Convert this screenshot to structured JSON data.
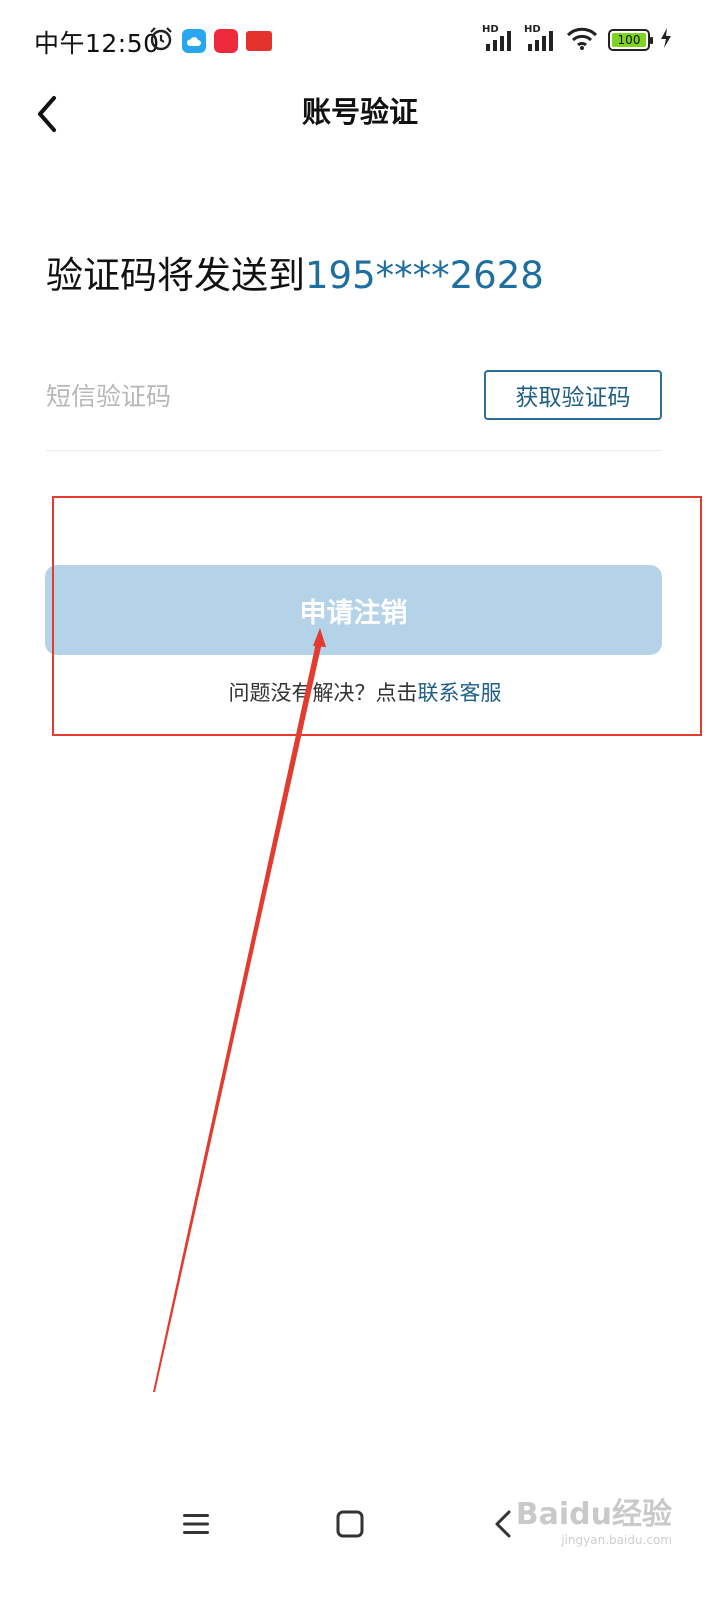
{
  "status_bar": {
    "time": "中午12:50",
    "app_icons": [
      {
        "name": "alarm-icon"
      },
      {
        "name": "cloud-app-icon",
        "color": "#28a7f0"
      },
      {
        "name": "xiaohongshu-app-icon",
        "color": "#ee2a3c"
      },
      {
        "name": "toutiao-app-icon",
        "color": "#e5322d"
      }
    ],
    "signal1_label": "HD",
    "signal2_label": "HD",
    "battery_level": "100",
    "battery_color": "#7ed321"
  },
  "header": {
    "title": "账号验证"
  },
  "verify": {
    "heading_prefix": "验证码将发送到",
    "phone": "195****2628",
    "sms_placeholder": "短信验证码",
    "sms_value": "",
    "get_code_label": "获取验证码",
    "apply_label": "申请注销",
    "help_prefix": "问题没有解决？点击",
    "help_link": "联系客服"
  },
  "colors": {
    "accent": "#1e6e9f",
    "apply_button_disabled": "#b4d3e8",
    "annotation": "#e23b30"
  },
  "watermark": {
    "main": "Baidu经验",
    "url": "jingyan.baidu.com"
  }
}
